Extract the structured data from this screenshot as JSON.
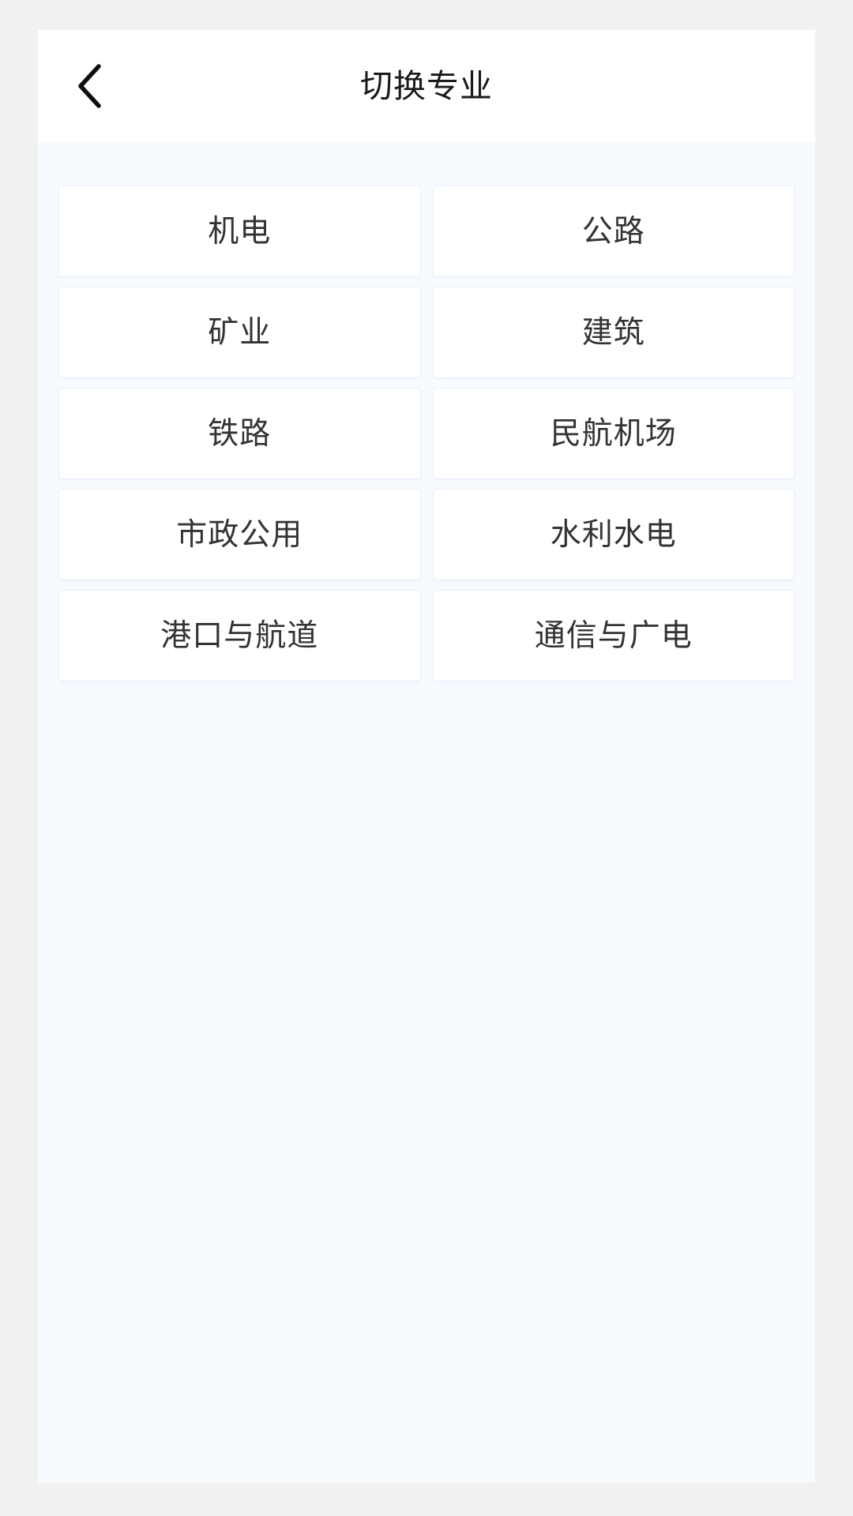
{
  "app": {
    "background_color": "#f1f1f1",
    "frame_background_color": "#f7faff"
  },
  "navbar": {
    "title": "切换专业",
    "back_icon": "chevron-left-icon",
    "background_color": "#ffffff",
    "title_color": "#1a1a1a"
  },
  "main": {
    "columns": 2,
    "card_background_color": "#ffffff",
    "card_text_color": "#333333",
    "items": [
      {
        "label": "机电"
      },
      {
        "label": "公路"
      },
      {
        "label": "矿业"
      },
      {
        "label": "建筑"
      },
      {
        "label": "铁路"
      },
      {
        "label": "民航机场"
      },
      {
        "label": "市政公用"
      },
      {
        "label": "水利水电"
      },
      {
        "label": "港口与航道"
      },
      {
        "label": "通信与广电"
      }
    ]
  }
}
